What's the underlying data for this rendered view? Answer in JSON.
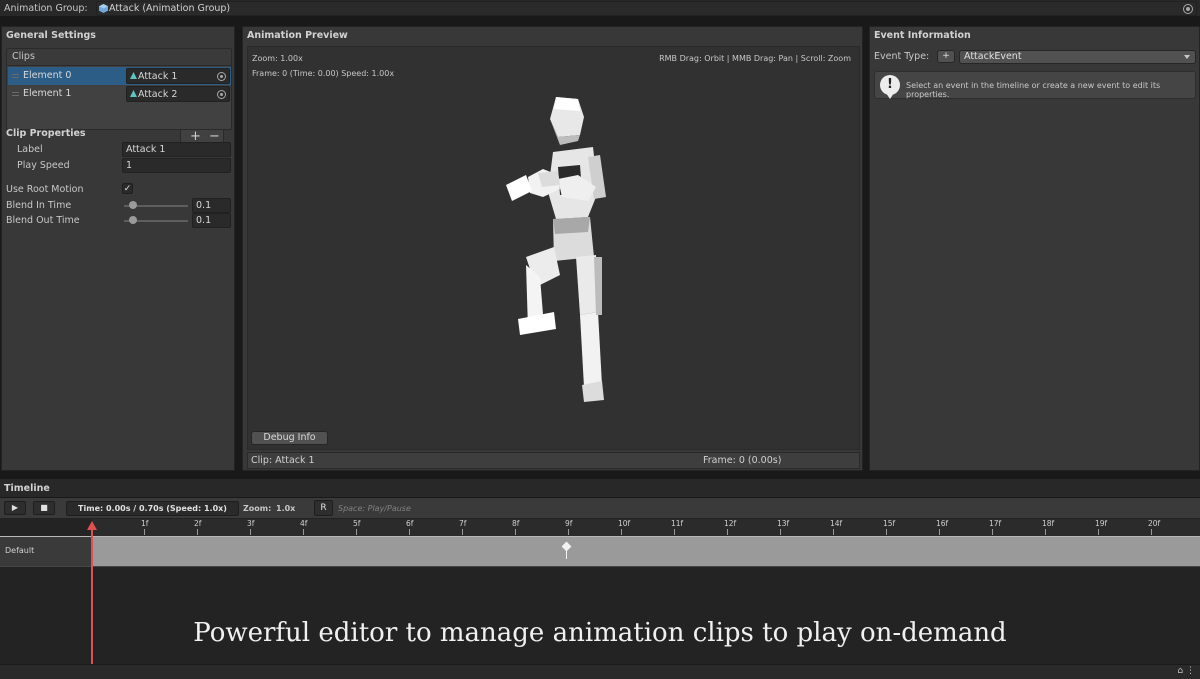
{
  "top": {
    "label": "Animation Group:",
    "value": "Attack (Animation Group)"
  },
  "general": {
    "title": "General Settings",
    "clips_header": "Clips",
    "clips": [
      {
        "label": "Element 0",
        "value": "Attack 1"
      },
      {
        "label": "Element 1",
        "value": "Attack 2"
      }
    ],
    "add": "+",
    "remove": "−",
    "clip_properties": "Clip Properties",
    "label_label": "Label",
    "label_value": "Attack 1",
    "speed_label": "Play Speed",
    "speed_value": "1",
    "root_motion_label": "Use Root Motion",
    "root_motion_checked": "✓",
    "blend_in_label": "Blend In Time",
    "blend_in_value": "0.1",
    "blend_out_label": "Blend Out Time",
    "blend_out_value": "0.1"
  },
  "preview": {
    "title": "Animation Preview",
    "zoom": "Zoom: 1.00x",
    "frame_info": "Frame: 0 (Time: 0.00) Speed: 1.00x",
    "controls": "RMB Drag: Orbit | MMB Drag: Pan | Scroll: Zoom",
    "debug_button": "Debug Info",
    "clip_footer": "Clip: Attack 1",
    "frame_footer": "Frame: 0 (0.00s)"
  },
  "event": {
    "title": "Event Information",
    "type_label": "Event Type:",
    "add": "+",
    "type_value": "AttackEvent",
    "help": "Select an event in the timeline or create a new event to edit its properties."
  },
  "timeline": {
    "title": "Timeline",
    "play_icon": "▶",
    "stop_icon": "■",
    "time": "Time: 0.00s / 0.70s (Speed: 1.0x)",
    "zoom_label": "Zoom:",
    "zoom_value": "1.0x",
    "reset": "R",
    "hint": "Space: Play/Pause",
    "ticks": [
      "1f",
      "2f",
      "3f",
      "4f",
      "5f",
      "6f",
      "7f",
      "8f",
      "9f",
      "10f",
      "11f",
      "12f",
      "13f",
      "14f",
      "15f",
      "16f",
      "17f",
      "18f",
      "19f",
      "20f"
    ],
    "track": "Default"
  },
  "caption": "Powerful editor to manage animation clips to play on-demand",
  "status_icons": "⌂ ⋮"
}
